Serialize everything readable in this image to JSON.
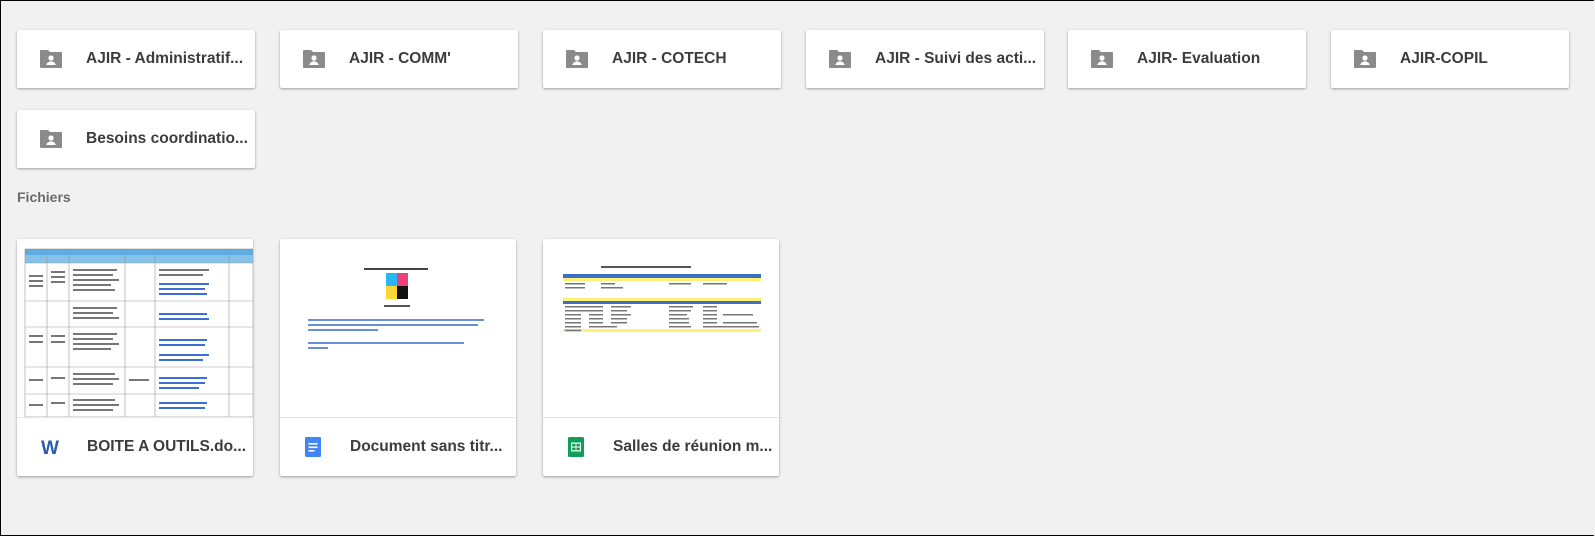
{
  "folders": [
    {
      "name": "AJIR - Administratif...",
      "icon": "shared-folder-icon"
    },
    {
      "name": "AJIR - COMM'",
      "icon": "shared-folder-icon"
    },
    {
      "name": "AJIR - COTECH",
      "icon": "shared-folder-icon"
    },
    {
      "name": "AJIR - Suivi des acti...",
      "icon": "shared-folder-icon"
    },
    {
      "name": "AJIR- Evaluation",
      "icon": "shared-folder-icon"
    },
    {
      "name": "AJIR-COPIL",
      "icon": "shared-folder-icon"
    },
    {
      "name": "Besoins coordinatio...",
      "icon": "shared-folder-icon"
    }
  ],
  "files_section_label": "Fichiers",
  "files": [
    {
      "name": "BOITE A OUTILS.do...",
      "icon": "word-doc-icon",
      "icon_color": "#2a5db0"
    },
    {
      "name": "Document sans titr...",
      "icon": "google-docs-icon",
      "icon_color": "#4285f4"
    },
    {
      "name": "Salles de réunion m...",
      "icon": "google-sheets-icon",
      "icon_color": "#0f9d58"
    }
  ],
  "colors": {
    "background": "#f1f1f1",
    "card": "#ffffff",
    "folder_icon": "#8a8a8a",
    "text": "#3c3c3c"
  }
}
